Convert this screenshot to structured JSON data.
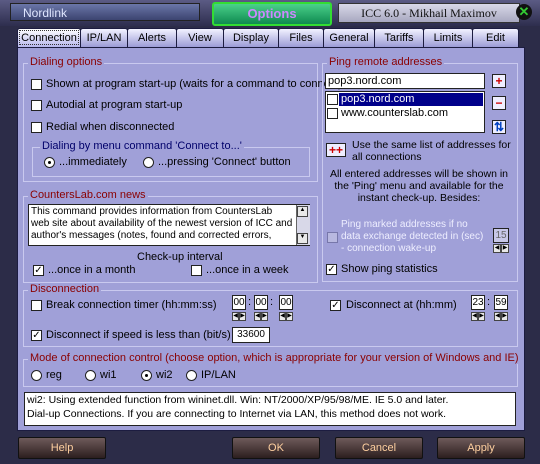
{
  "window": {
    "app_name": "Nordlink",
    "title": "Options",
    "right_title": "ICC 6.0 - Mikhail Maximov",
    "close_glyph": "✕"
  },
  "tabs": [
    "Connection",
    "IP/LAN",
    "Alerts",
    "View",
    "Display",
    "Files",
    "General",
    "Tariffs",
    "Limits",
    "Edit"
  ],
  "dialing": {
    "title": "Dialing options",
    "shown_at_startup": "Shown at program start-up (waits for a command to connect)",
    "autodial": "Autodial at program start-up",
    "redial": "Redial when disconnected",
    "menu_title": "Dialing by menu command 'Connect to...'",
    "immediately": "...immediately",
    "pressing": "...pressing 'Connect' button"
  },
  "news": {
    "title": "CountersLab.com news",
    "text": "This command provides information from CountersLab web site about availability of the newest version of ICC and author's messages (notes, found and corrected errors,",
    "interval_label": "Check-up interval",
    "monthly": "...once in a month",
    "weekly": "...once in a week"
  },
  "ping": {
    "title": "Ping remote addresses",
    "input_value": "pop3.nord.com",
    "addresses": [
      "pop3.nord.com",
      "www.counterslab.com"
    ],
    "same_list": "Use the same list of addresses for all connections",
    "info": "All entered addresses will be shown in the 'Ping' menu and available for the instant check-up. Besides:",
    "marked_label": "Ping marked addresses if no data exchange detected in (sec) - connection wake-up",
    "seconds_value": "15",
    "show_stats": "Show ping statistics"
  },
  "disconnection": {
    "title": "Disconnection",
    "break_timer": "Break connection timer (hh:mm:ss)",
    "timer_values": [
      "00",
      "00",
      "00"
    ],
    "disconnect_at": "Disconnect at (hh:mm)",
    "at_values": [
      "23",
      "59"
    ],
    "speed_label": "Disconnect if speed is less than (bit/s)",
    "speed_value": "33600"
  },
  "mode": {
    "title": "Mode of connection control (choose option, which is appropriate for your version of Windows and IE)",
    "options": [
      "reg",
      "wi1",
      "wi2",
      "IP/LAN"
    ],
    "selected": "wi2",
    "info_line1": "wi2: Using extended function from wininet.dll. Win: NT/2000/XP/95/98/ME. IE 5.0 and later.",
    "info_line2": "Dial-up Connections. If you are connecting to Internet via LAN,  this method does not work."
  },
  "buttons": {
    "help": "Help",
    "ok": "OK",
    "cancel": "Cancel",
    "apply": "Apply"
  }
}
